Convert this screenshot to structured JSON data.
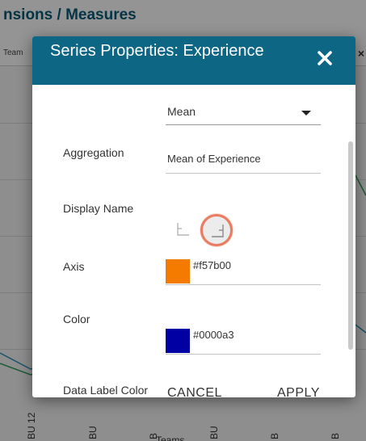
{
  "background": {
    "title": "nsions / Measures",
    "tab_label": "Team",
    "tab_close": "×",
    "x_labels": [
      "BU 12",
      "BU",
      "B",
      "BU",
      "B",
      "B",
      "B"
    ],
    "x_axis_title": "Teams"
  },
  "dialog": {
    "title": "Series Properties: Experience",
    "close_icon": "close-icon",
    "fields": {
      "aggregation": {
        "label": "Aggregation",
        "value": "Mean"
      },
      "display_name": {
        "label": "Display Name",
        "value": "Mean of Experience"
      },
      "axis": {
        "label": "Axis",
        "options": [
          "left-axis-icon",
          "right-axis-icon"
        ],
        "selected": "right"
      },
      "color": {
        "label": "Color",
        "hex": "#f57b00"
      },
      "data_label_color": {
        "label": "Data Label Color",
        "hex": "#0000a3"
      }
    },
    "buttons": {
      "cancel": "CANCEL",
      "apply": "APPLY"
    }
  },
  "colors": {
    "header": "#0d6683",
    "accent_ring": "#e87b60"
  }
}
